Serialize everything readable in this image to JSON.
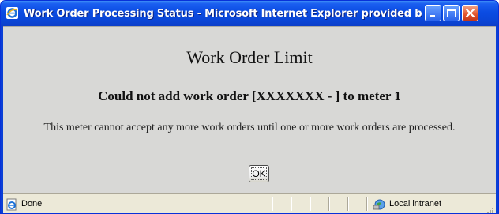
{
  "window": {
    "title": "Work Order Processing Status - Microsoft Internet Explorer provided by Gra…"
  },
  "page": {
    "heading": "Work Order Limit",
    "subheading": "Could not add work order [XXXXXXX - ] to meter 1",
    "message": "This meter cannot accept any more work orders until one or more work orders are processed.",
    "ok_label": "OK"
  },
  "statusbar": {
    "status": "Done",
    "zone": "Local intranet"
  },
  "icons": {
    "app": "ie-icon",
    "minimize": "minimize-icon",
    "maximize": "maximize-icon",
    "close": "close-icon",
    "status": "page-done-icon",
    "zone": "intranet-icon"
  },
  "colors": {
    "titlebar": "#0a46d8",
    "content_bg": "#d8d8d6",
    "statusbar_bg": "#ece9d8",
    "close_button": "#e2542d"
  }
}
